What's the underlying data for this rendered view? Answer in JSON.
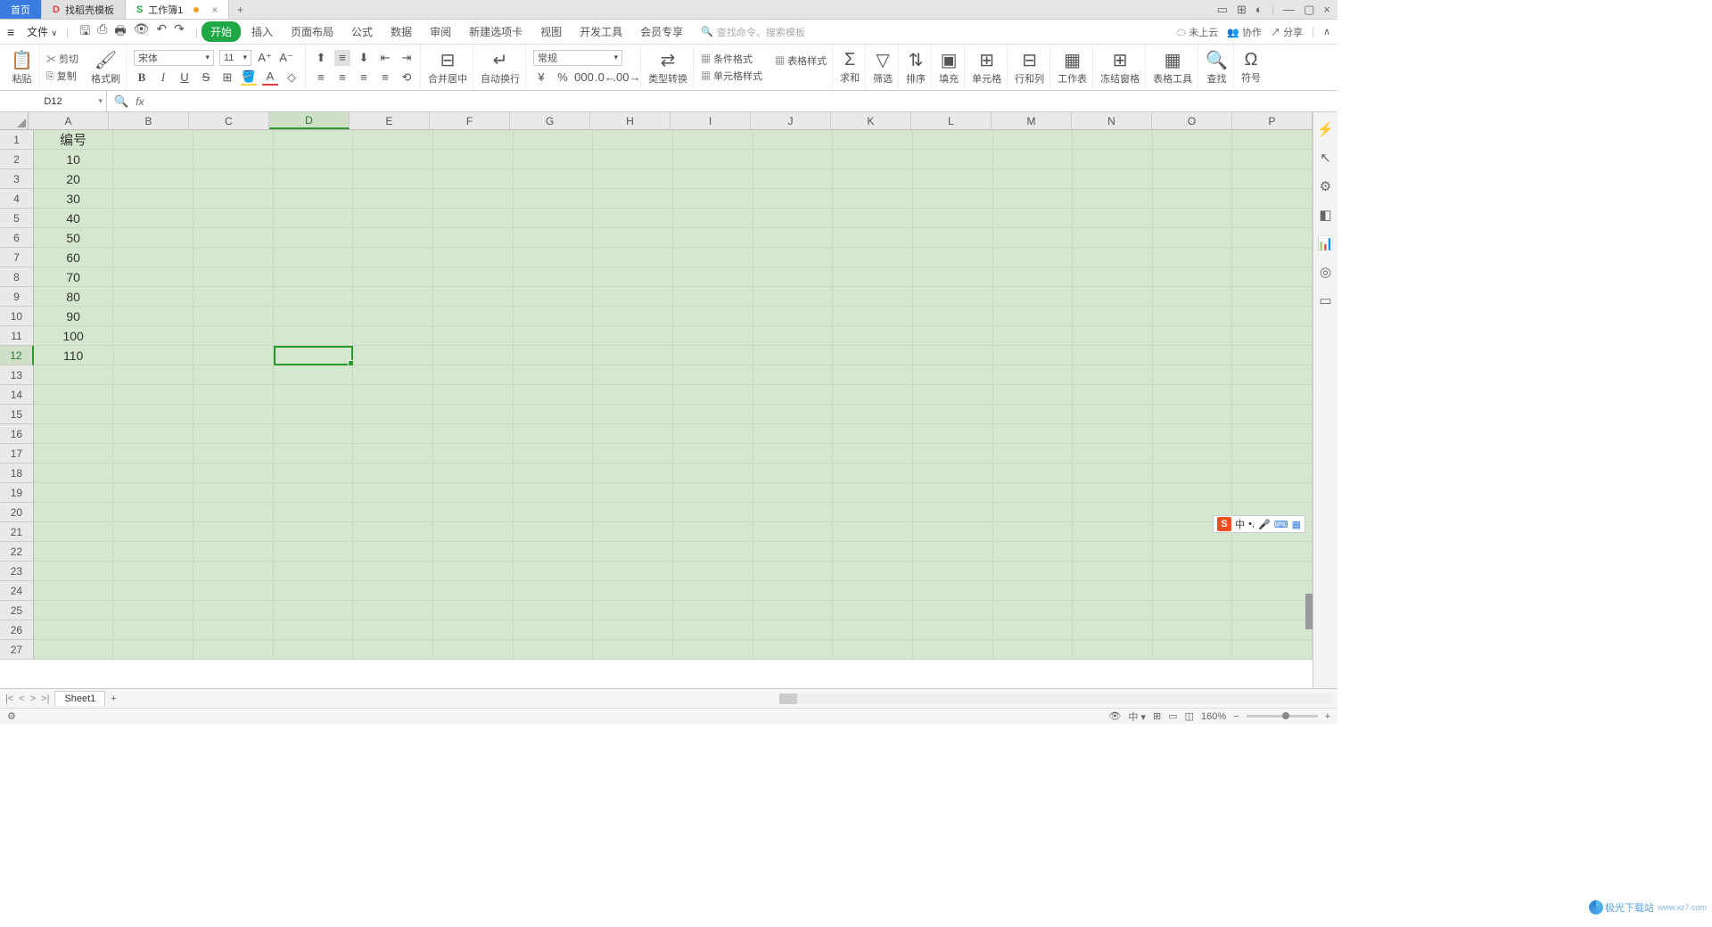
{
  "titlebar": {
    "home": "首页",
    "tab2": "找稻壳模板",
    "tab3": "工作簿1",
    "plus": "+"
  },
  "menurow": {
    "file": "文件",
    "tabs": [
      "开始",
      "插入",
      "页面布局",
      "公式",
      "数据",
      "审阅",
      "新建选项卡",
      "视图",
      "开发工具",
      "会员专享"
    ],
    "search_placeholder": "查找命令、搜索模板",
    "cloud": "未上云",
    "collab": "协作",
    "share": "分享"
  },
  "ribbon": {
    "paste": "粘贴",
    "cut": "剪切",
    "copy": "复制",
    "format_painter": "格式刷",
    "font_name": "宋体",
    "font_size": "11",
    "merge": "合并居中",
    "wrap": "自动换行",
    "number_format": "常规",
    "type_convert": "类型转换",
    "cond_format": "条件格式",
    "table_style": "表格样式",
    "cell_style": "单元格样式",
    "sum": "求和",
    "filter": "筛选",
    "sort": "排序",
    "fill": "填充",
    "cell": "单元格",
    "rowcol": "行和列",
    "sheet": "工作表",
    "freeze": "冻结窗格",
    "table_tool": "表格工具",
    "find": "查找",
    "symbol": "符号"
  },
  "formula_bar": {
    "namebox": "D12",
    "fx": "fx"
  },
  "grid": {
    "columns": [
      "A",
      "B",
      "C",
      "D",
      "E",
      "F",
      "G",
      "H",
      "I",
      "J",
      "K",
      "L",
      "M",
      "N",
      "O",
      "P"
    ],
    "rows": 27,
    "selected_cell": {
      "row": 12,
      "col": "D"
    },
    "data": {
      "A1": "编号",
      "A2": "10",
      "A3": "20",
      "A4": "30",
      "A5": "40",
      "A6": "50",
      "A7": "60",
      "A8": "70",
      "A9": "80",
      "A10": "90",
      "A11": "100",
      "A12": "110"
    }
  },
  "ime": {
    "lang": "中",
    "punct": "•,",
    "voice": "🎤",
    "kbd": "⌨",
    "grid": "▦"
  },
  "sheetbar": {
    "sheet": "Sheet1",
    "add": "+"
  },
  "statusbar": {
    "zoom": "160%",
    "watermark": "极光下载站",
    "watermark_url": "www.xz7.com"
  }
}
